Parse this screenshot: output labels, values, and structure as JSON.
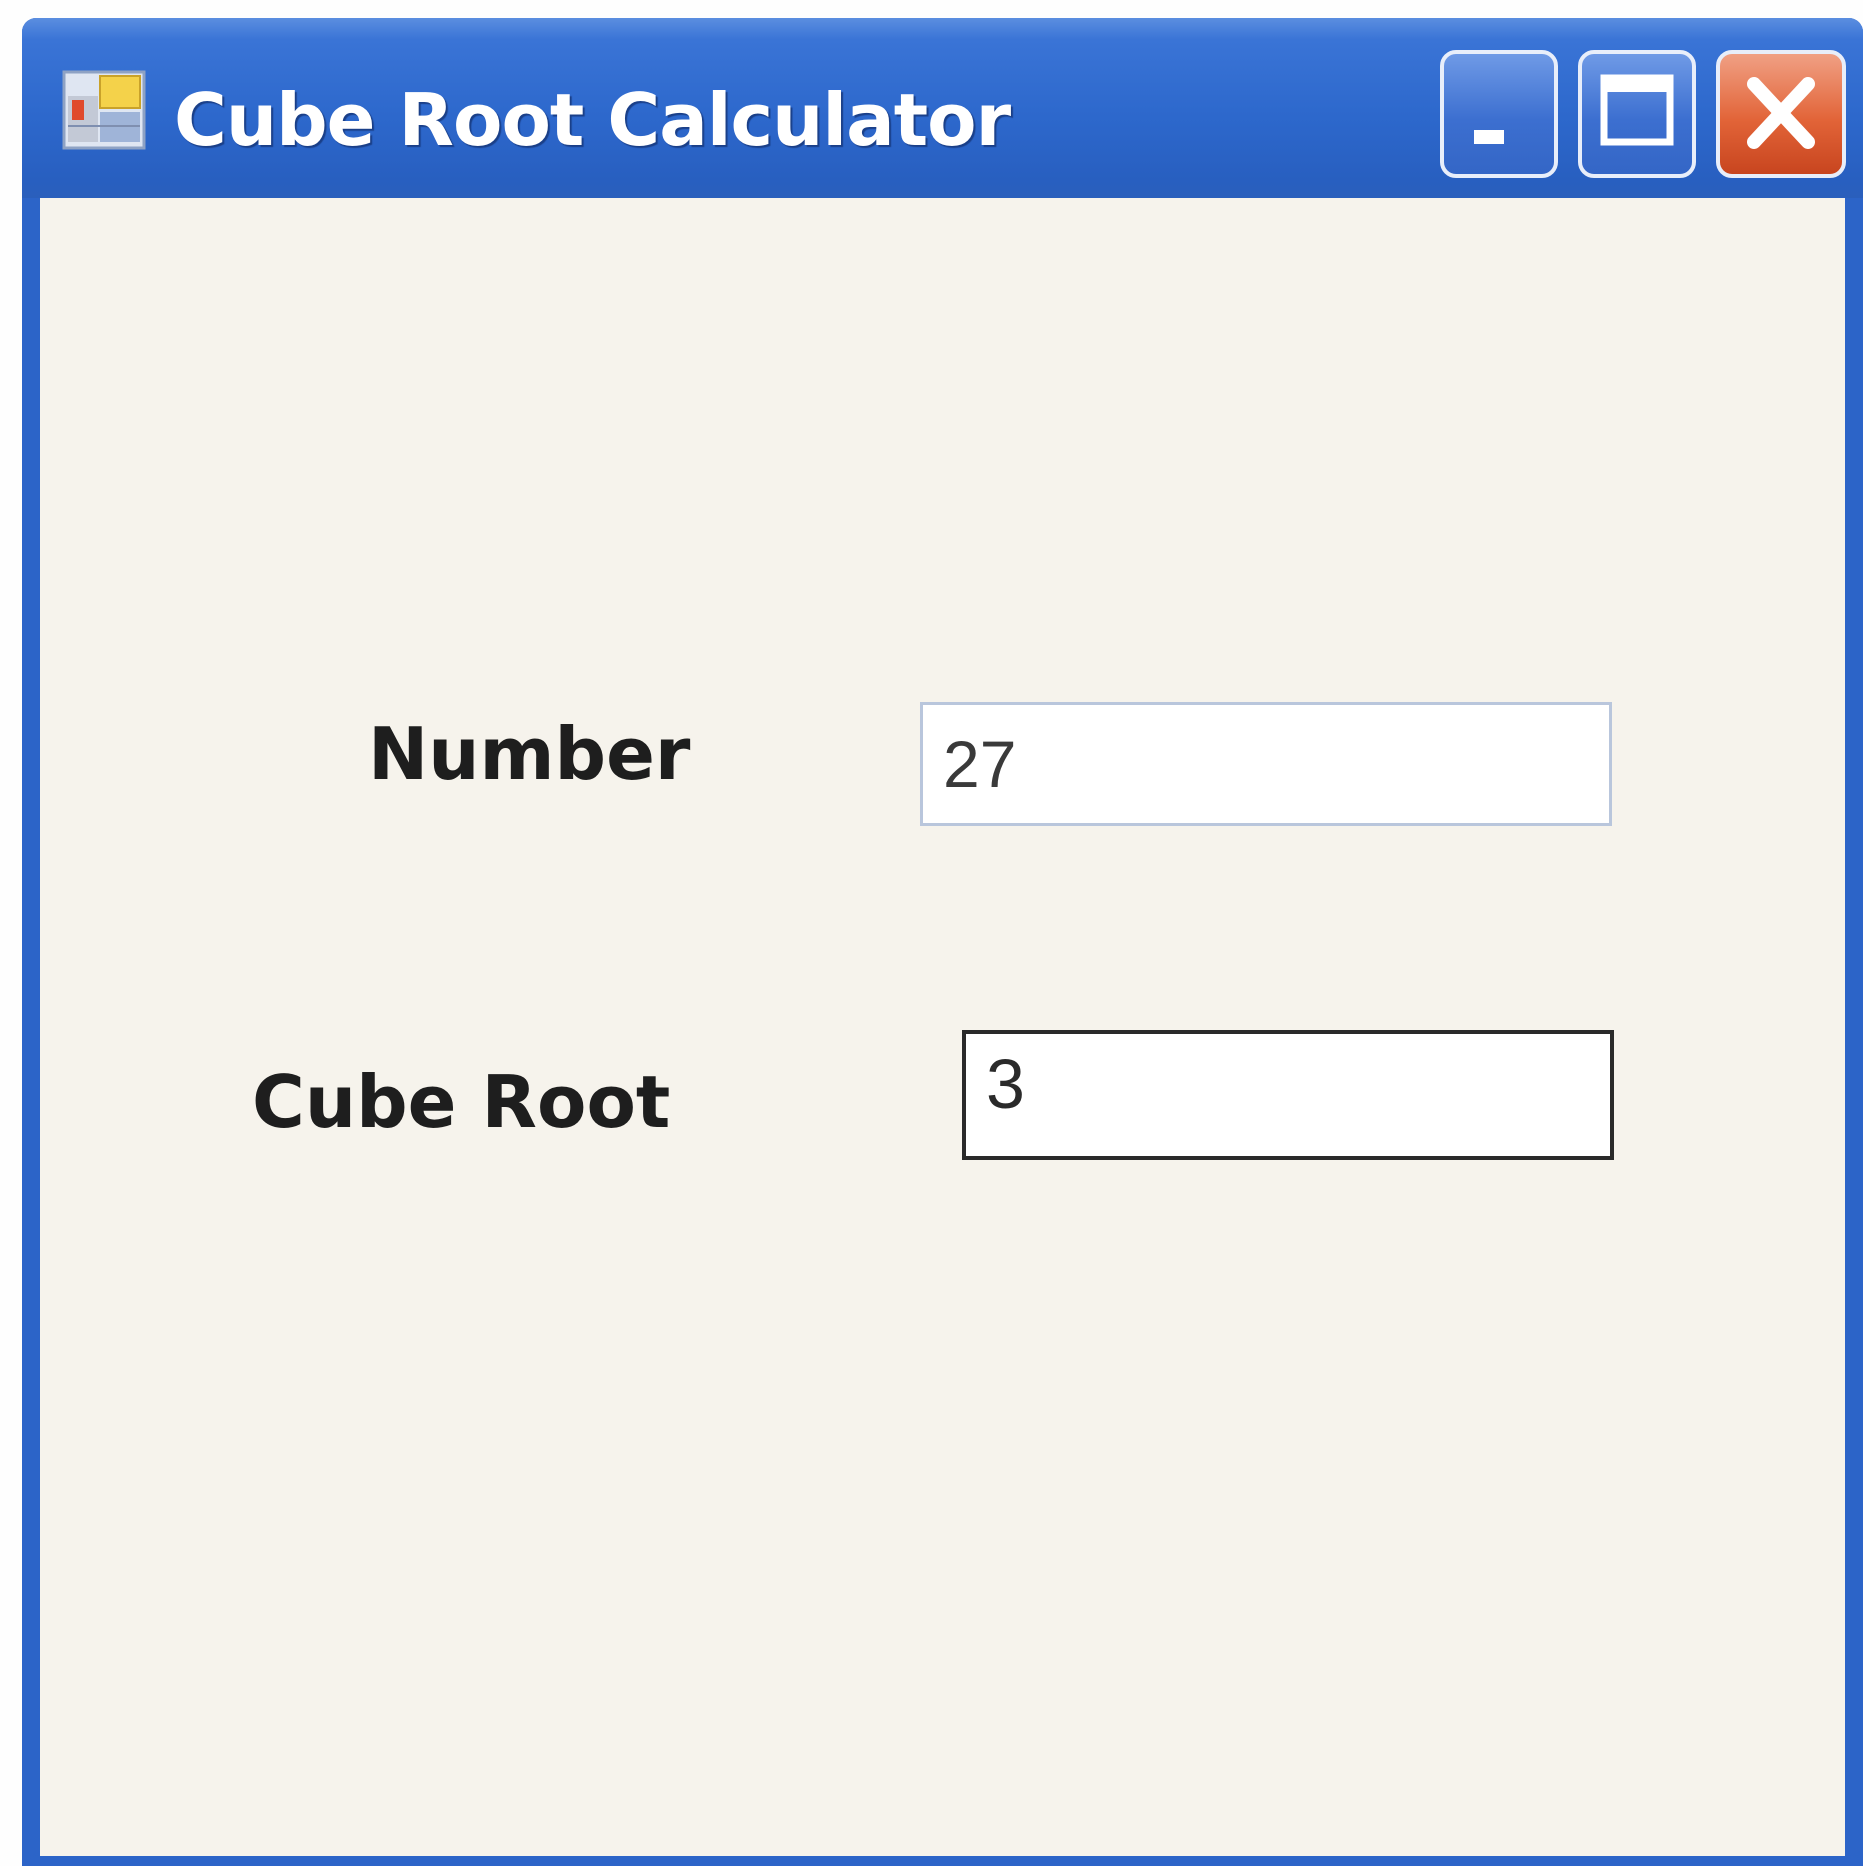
{
  "window": {
    "title": "Cube Root Calculator",
    "controls": {
      "minimize_icon": "minimize-icon",
      "maximize_icon": "maximize-icon",
      "close_icon": "close-icon"
    }
  },
  "form": {
    "number_label": "Number",
    "number_value": "27",
    "cube_root_label": "Cube Root",
    "cube_root_value": "3"
  },
  "colors": {
    "titlebar": "#2d68cc",
    "close_button": "#e26438",
    "client_background": "#f6f3ec"
  }
}
